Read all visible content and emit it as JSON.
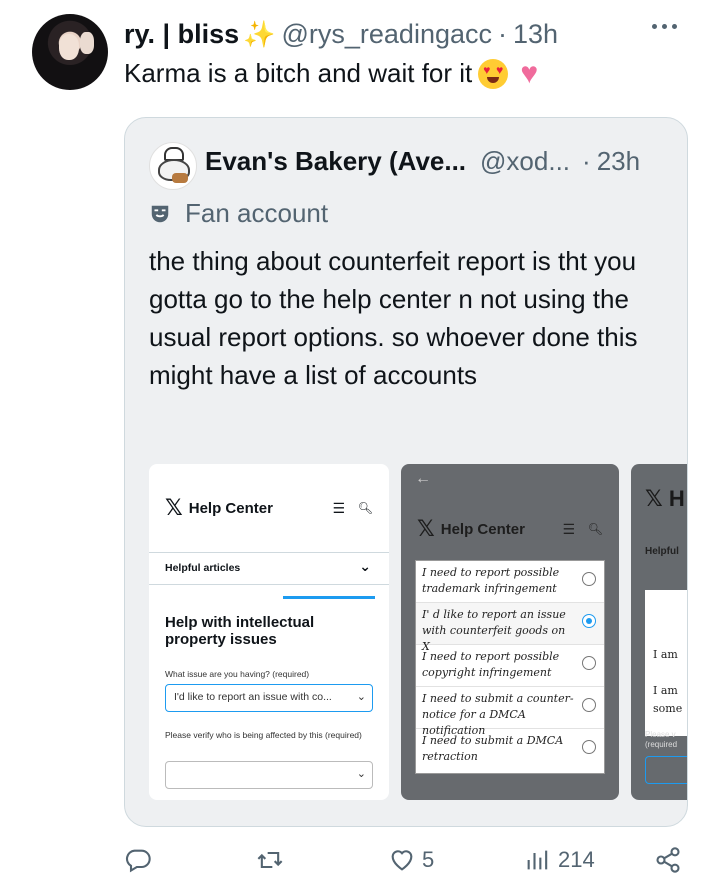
{
  "tweet": {
    "author_name": "ry. | bliss",
    "handle": "@rys_readingacc",
    "dot": "·",
    "time": "13h",
    "text": "Karma is a bitch and wait for it",
    "emojis": [
      "smiling-face-with-heart-eyes",
      "sparkling-heart"
    ]
  },
  "quote": {
    "author_name": "Evan's Bakery (Ave...",
    "handle": "@xod...",
    "dot": "·",
    "time": "23h",
    "label": "Fan account",
    "text": "the thing about counterfeit report is tht you gotta go to the help center n not using the usual report options. so whoever done this might have a list of accounts",
    "images": {
      "first": {
        "logo": "𝕏",
        "title": "Help Center",
        "helpful": "Helpful articles",
        "heading": "Help with intellectual property issues",
        "q1": "What issue are you having? (required)",
        "q1_value": "I'd like to report an issue with co...",
        "q2": "Please verify who is being affected by this (required)"
      },
      "second": {
        "logo": "𝕏",
        "title": "Help Center",
        "options": [
          {
            "text": "I need to report possible trademark infringement",
            "selected": false
          },
          {
            "text": "I' d like to report an issue with counterfeit goods on X",
            "selected": true
          },
          {
            "text": "I need to report possible copyright infringement",
            "selected": false
          },
          {
            "text": "I need to submit a counter-notice for a DMCA notification",
            "selected": false
          },
          {
            "text": "I need to submit a DMCA retraction",
            "selected": false
          }
        ]
      },
      "third": {
        "logo": "𝕏 H",
        "helpful": "Helpful",
        "line1": "I am",
        "line2": "I am",
        "line3": "some",
        "please": "Please v",
        "required": "(required"
      }
    }
  },
  "actions": {
    "reply_icon": "reply-icon",
    "retweet_icon": "retweet-icon",
    "like_icon": "like-icon",
    "like_count": "5",
    "views_icon": "views-icon",
    "views_count": "214",
    "share_icon": "share-icon"
  },
  "colors": {
    "accent": "#1d9bf0",
    "secondary_text": "#536471",
    "quote_bg": "#eef0f2",
    "sparkle": "#f4b400"
  }
}
